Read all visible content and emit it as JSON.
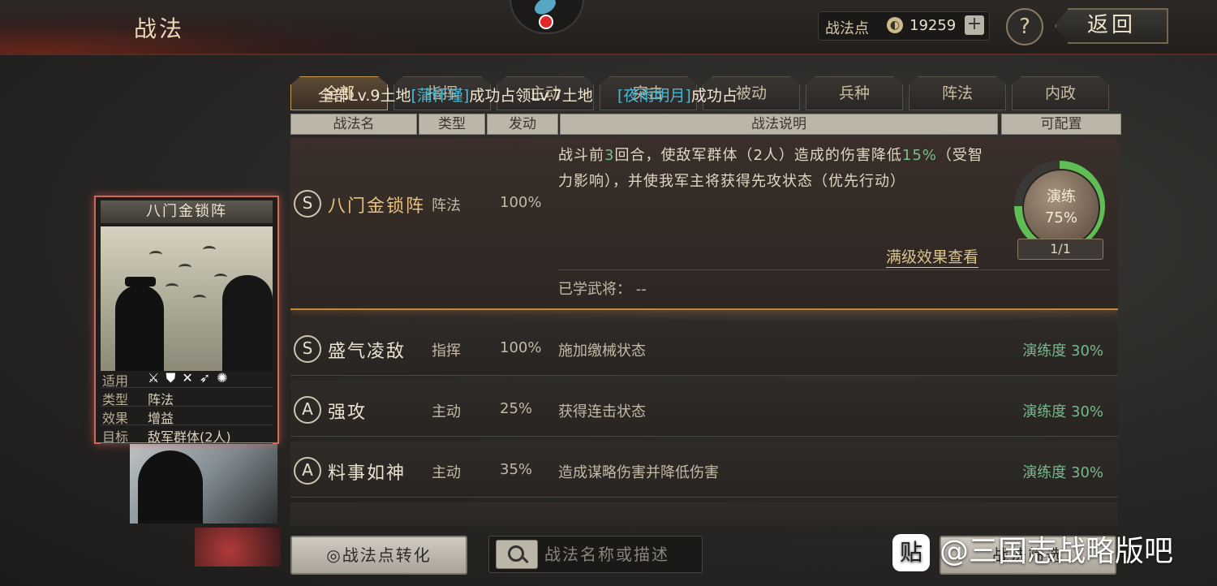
{
  "header": {
    "title": "战法",
    "points_label": "战法点",
    "points_value": "19259",
    "plus": "+",
    "help": "?",
    "back": "返回"
  },
  "tabs": [
    {
      "label": "全部",
      "active": true
    },
    {
      "label": "指挥"
    },
    {
      "label": "主动"
    },
    {
      "label": "突击"
    },
    {
      "label": "被动"
    },
    {
      "label": "兵种"
    },
    {
      "label": "阵法"
    },
    {
      "label": "内政"
    }
  ],
  "notice": {
    "part1": "全部Lv.9土地",
    "name1": "[蒲怀瑾]",
    "part2": "成功占领Lv.7土地",
    "name2": "[夜雨明月]",
    "part3": "成功占"
  },
  "table_header": [
    "战法名",
    "类型",
    "发动",
    "战法说明",
    "可配置"
  ],
  "expanded_row": {
    "grade": "S",
    "name": "八门金锁阵",
    "type": "阵法",
    "rate": "100%",
    "desc_a": "战斗前",
    "desc_num1": "3",
    "desc_b": "回合，使敌军群体（2人）造成的伤害降低",
    "desc_num2": "15%",
    "desc_c": "（受智力影响），并使我军主将获得先攻状态（优先行动）",
    "full_link": "满级效果查看",
    "learned": "已学武将：  --",
    "drill_label": "演练",
    "drill_value": "75%",
    "drill_progress": 0.75,
    "slots": "1/1"
  },
  "rows": [
    {
      "grade": "S",
      "name": "盛气凌敌",
      "type": "指挥",
      "rate": "100%",
      "desc": "施加缴械状态",
      "drill": "演练度 30%"
    },
    {
      "grade": "A",
      "name": "强攻",
      "type": "主动",
      "rate": "25%",
      "desc": "获得连击状态",
      "drill": "演练度 30%"
    },
    {
      "grade": "A",
      "name": "料事如神",
      "type": "主动",
      "rate": "35%",
      "desc": "造成谋略伤害并降低伤害",
      "drill": "演练度 30%"
    }
  ],
  "card": {
    "title": "八门金锁阵",
    "apply_label": "适用",
    "type_label": "类型",
    "type_value": "阵法",
    "effect_label": "效果",
    "effect_value": "增益",
    "target_label": "目标",
    "target_value": "敌军群体(2人)"
  },
  "bottom": {
    "convert": "战法点转化",
    "search_placeholder": "战法名称或描述",
    "filter": "战法筛选"
  },
  "watermark": {
    "logo": "贴",
    "text": "@三国志战略版吧"
  },
  "colors": {
    "accent_gold": "#e8c17a",
    "drill_green": "#78b88a",
    "notice_blue": "#45b9d8",
    "card_border": "#cf6a5a"
  }
}
